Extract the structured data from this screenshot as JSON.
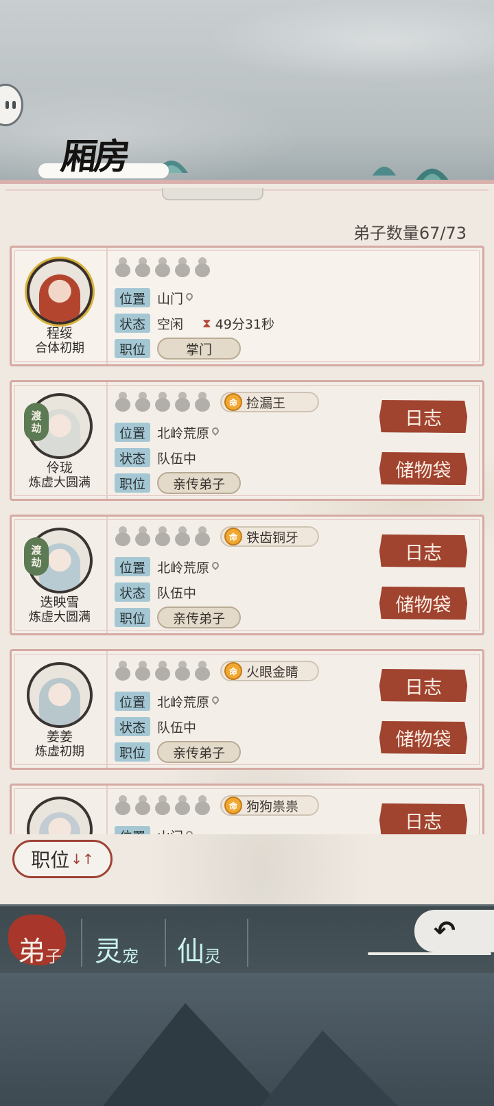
{
  "title": "厢房",
  "disciple_count": "弟子数量67/73",
  "labels": {
    "location": "位置",
    "status": "状态",
    "position": "职位"
  },
  "disciples": [
    {
      "name": "程绥",
      "realm": "合体初期",
      "dujie": false,
      "location": "山门",
      "status": "空闲",
      "timer": "49分31秒",
      "position": "掌门",
      "trait": "",
      "buttons": []
    },
    {
      "name": "伶珑",
      "realm": "炼虚大圆满",
      "dujie": true,
      "location": "北岭荒原",
      "status": "队伍中",
      "timer": "",
      "position": "亲传弟子",
      "trait": "捡漏王",
      "buttons": [
        "日志",
        "储物袋"
      ]
    },
    {
      "name": "迭映雪",
      "realm": "炼虚大圆满",
      "dujie": true,
      "location": "北岭荒原",
      "status": "队伍中",
      "timer": "",
      "position": "亲传弟子",
      "trait": "铁齿铜牙",
      "buttons": [
        "日志",
        "储物袋"
      ]
    },
    {
      "name": "姜姜",
      "realm": "炼虚初期",
      "dujie": false,
      "location": "北岭荒原",
      "status": "队伍中",
      "timer": "",
      "position": "亲传弟子",
      "trait": "火眼金睛",
      "buttons": [
        "日志",
        "储物袋"
      ]
    },
    {
      "name": "",
      "realm": "",
      "dujie": false,
      "location": "山门",
      "status": "",
      "timer": "",
      "position": "",
      "trait": "狗狗祟祟",
      "buttons": [
        "日志"
      ]
    }
  ],
  "dujie_text": [
    "渡",
    "劫"
  ],
  "ming_char": "命",
  "sort_button": {
    "label": "职位",
    "arrows": "↓↑"
  },
  "tabs": [
    {
      "big": "弟",
      "small": "子",
      "active": true
    },
    {
      "big": "灵",
      "small": "宠",
      "active": false
    },
    {
      "big": "仙",
      "small": "灵",
      "active": false
    }
  ],
  "colors": {
    "accent": "#a0432f",
    "label_bg": "#a5c7d3",
    "card_border": "#d6a9a3"
  }
}
